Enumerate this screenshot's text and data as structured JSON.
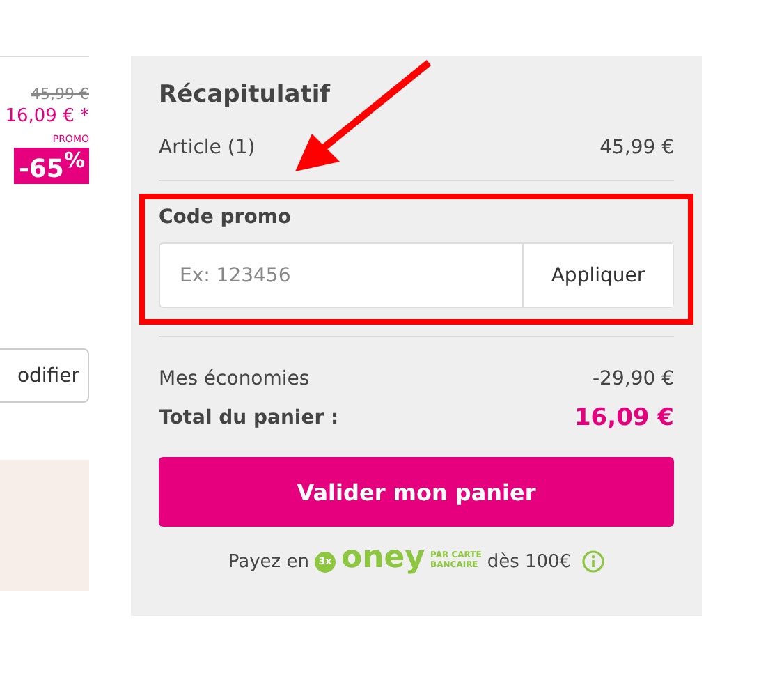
{
  "product": {
    "old_price": "45,99 €",
    "price": "16,09 € *",
    "promo_label": "PROMO",
    "discount": "-65$^{%}$",
    "modify_button": "odifier"
  },
  "summary": {
    "title": "Récapitulatif",
    "article": {
      "label": "Article (1)",
      "value": "45,99 €"
    },
    "promo": {
      "label": "Code promo",
      "placeholder": "Ex: 123456",
      "button": "Appliquer"
    },
    "savings": {
      "label": "Mes économies",
      "value": "-29,90 €"
    },
    "total": {
      "label": "Total du panier :",
      "value": "16,09 €"
    },
    "checkout_button": "Valider mon panier",
    "installments": {
      "prefix": "Payez en",
      "badge": "3x",
      "brand": "oney",
      "brand_line_1": "PAR CARTE",
      "brand_line_2": "BANCAIRE",
      "suffix": "dès 100€"
    }
  }
}
